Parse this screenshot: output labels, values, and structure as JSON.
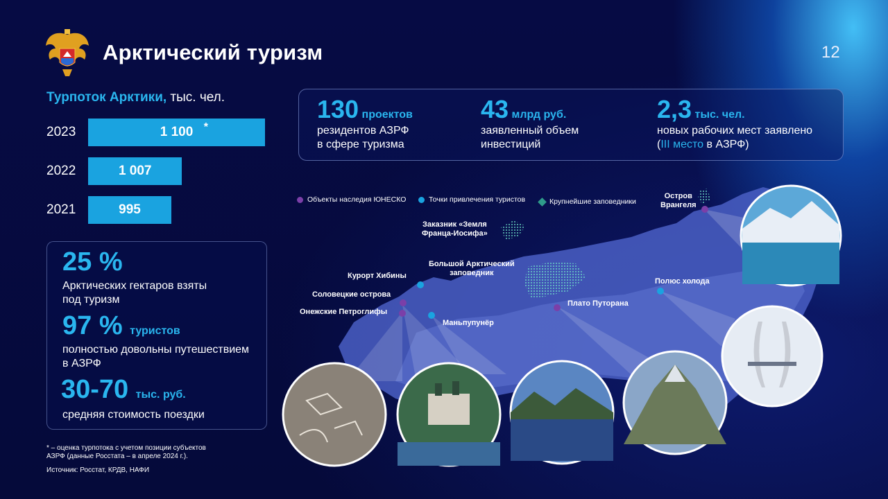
{
  "header": {
    "title": "Арктический туризм",
    "page_number": "12"
  },
  "tourist_flow": {
    "title_highlight": "Турпоток Арктики,",
    "title_unit": " тыс. чел.",
    "star": "*",
    "rows": [
      {
        "year": "2023",
        "value_label": "1 100",
        "value": 1100,
        "estimated": true
      },
      {
        "year": "2022",
        "value_label": "1 007",
        "value": 1007,
        "estimated": false
      },
      {
        "year": "2021",
        "value_label": "995",
        "value": 995,
        "estimated": false
      }
    ]
  },
  "kpis": {
    "k1_value": "25 %",
    "k1_text_1": "Арктических  гектаров взяты",
    "k1_text_2": "под туризм",
    "k2_value": "97 %",
    "k2_unit": "туристов",
    "k2_text_1": "полностью довольны путешествием",
    "k2_text_2": "в АЗРФ",
    "k3_value": "30-70",
    "k3_unit": "тыс. руб.",
    "k3_text": "средняя стоимость поездки"
  },
  "stats": {
    "s1_num": "130",
    "s1_unit": "проектов",
    "s1_line1": "резидентов АЗРФ",
    "s1_line2": "в сфере туризма",
    "s2_num": "43",
    "s2_unit": "млрд руб.",
    "s2_line1": "заявленный объем",
    "s2_line2": "инвестиций",
    "s3_num": "2,3",
    "s3_unit": "тыс. чел.",
    "s3_line1": "новых рабочих мест заявлено",
    "s3_line2_a": "(",
    "s3_line2_b": "III  место",
    "s3_line2_c": " в АЗРФ)"
  },
  "legend": {
    "unesco": "Объекты наследия ЮНЕСКО",
    "attractions": "Точки привлечения туристов",
    "reserves": "Крупнейшие заповедники"
  },
  "map_labels": {
    "wrangel_1": "Остров",
    "wrangel_2": "Врангеля",
    "franz_1": "Заказник «Земля",
    "franz_2": "Франца-Иосифа»",
    "arctic_reserve_1": "Большой  Арктический",
    "arctic_reserve_2": "заповедник",
    "khibiny": "Курорт  Хибины",
    "solovki": "Соловецкие  острова",
    "onega": "Онежские Петроглифы",
    "manpupuner": "Маньпупунёр",
    "putorana": "Плато Путорана",
    "cold_pole": "Полюс холода"
  },
  "colors": {
    "accent": "#2ab6ef",
    "bar": "#1aa3e0",
    "unesco": "#7b3fa8",
    "reserve": "#2f9c8a",
    "background": "#050a3c"
  },
  "footnote": {
    "line1": "* – оценка турпотока с учетом позиции субъектов",
    "line2": "АЗРФ (данные Росстата – в апреле 2024 г.).",
    "source": "Источник: Росстат, КРДВ, НАФИ"
  }
}
